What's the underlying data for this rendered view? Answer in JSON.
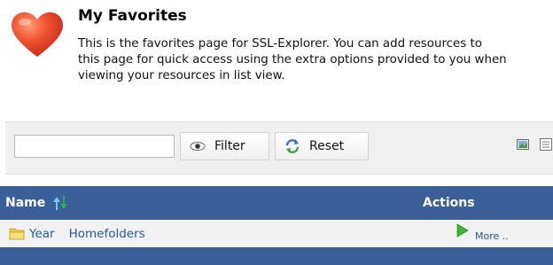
{
  "header": {
    "title": "My Favorites",
    "description_lines": [
      "This is the favorites page for SSL-Explorer. You can add resources to",
      "this page for quick access using the extra options provided to you when",
      "viewing your resources in list view."
    ],
    "icon": "heart-icon"
  },
  "filterbar": {
    "input_value": "",
    "filter_label": "Filter",
    "reset_label": "Reset",
    "filter_icon": "eye-icon",
    "reset_icon": "refresh-icon",
    "view_icons": [
      "icon-view-icon",
      "list-view-icon"
    ]
  },
  "table": {
    "columns": {
      "name": "Name",
      "actions": "Actions"
    },
    "sort_icon": "sort-icon",
    "rows": [
      {
        "name_part1": "Year",
        "name_part2": "Homefolders",
        "action": "More ..",
        "icon": "folder-icon"
      }
    ]
  },
  "colors": {
    "header_bar": "#3b5f99",
    "link": "#2a56a3",
    "heart": "#e8432f",
    "row_bg": "#f2f2f2",
    "toolbar_bg": "#f0f0f0"
  }
}
